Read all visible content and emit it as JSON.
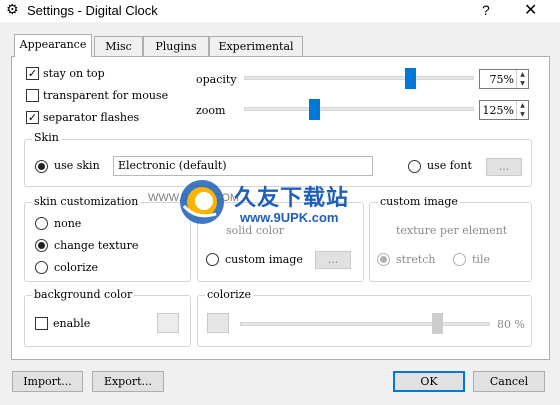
{
  "window": {
    "title": "Settings - Digital Clock",
    "help": "?",
    "close": "✕"
  },
  "tabs": [
    "Appearance",
    "Misc",
    "Plugins",
    "Experimental"
  ],
  "appearance": {
    "stay_on_top": {
      "label": "stay on top",
      "checked": true
    },
    "transparent_for_mouse": {
      "label": "transparent for mouse",
      "checked": false
    },
    "separator_flashes": {
      "label": "separator flashes",
      "checked": true
    },
    "opacity": {
      "label": "opacity",
      "value": "75%",
      "level": 0.75
    },
    "zoom": {
      "label": "zoom",
      "value": "125%"
    }
  },
  "skin": {
    "title": "Skin",
    "use_skin": "use skin",
    "skin_value": "Electronic (default)",
    "use_font": "use font",
    "font_button": "..."
  },
  "skin_customization": {
    "title": "skin customization",
    "options": [
      "none",
      "change texture",
      "colorize"
    ],
    "selected": "change texture"
  },
  "texture": {
    "solid_color": "solid color",
    "custom_image": "custom image",
    "image_button": "..."
  },
  "custom_image": {
    "title": "custom image",
    "texture_per_element": "texture per element",
    "stretch": "stretch",
    "tile": "tile"
  },
  "background_color": {
    "title": "background color",
    "enable": "enable"
  },
  "colorize": {
    "title": "colorize",
    "value": "80 %",
    "level": 0.8
  },
  "buttons": {
    "import": "Import...",
    "export": "Export...",
    "ok": "OK",
    "cancel": "Cancel"
  },
  "watermark": {
    "name": "久友下载站",
    "url": "www.9UPK.com",
    "site_left": "WWW.9UPK.COM"
  },
  "colors": {
    "accent": "#0078d7",
    "watermark": "#1e5fb8"
  }
}
